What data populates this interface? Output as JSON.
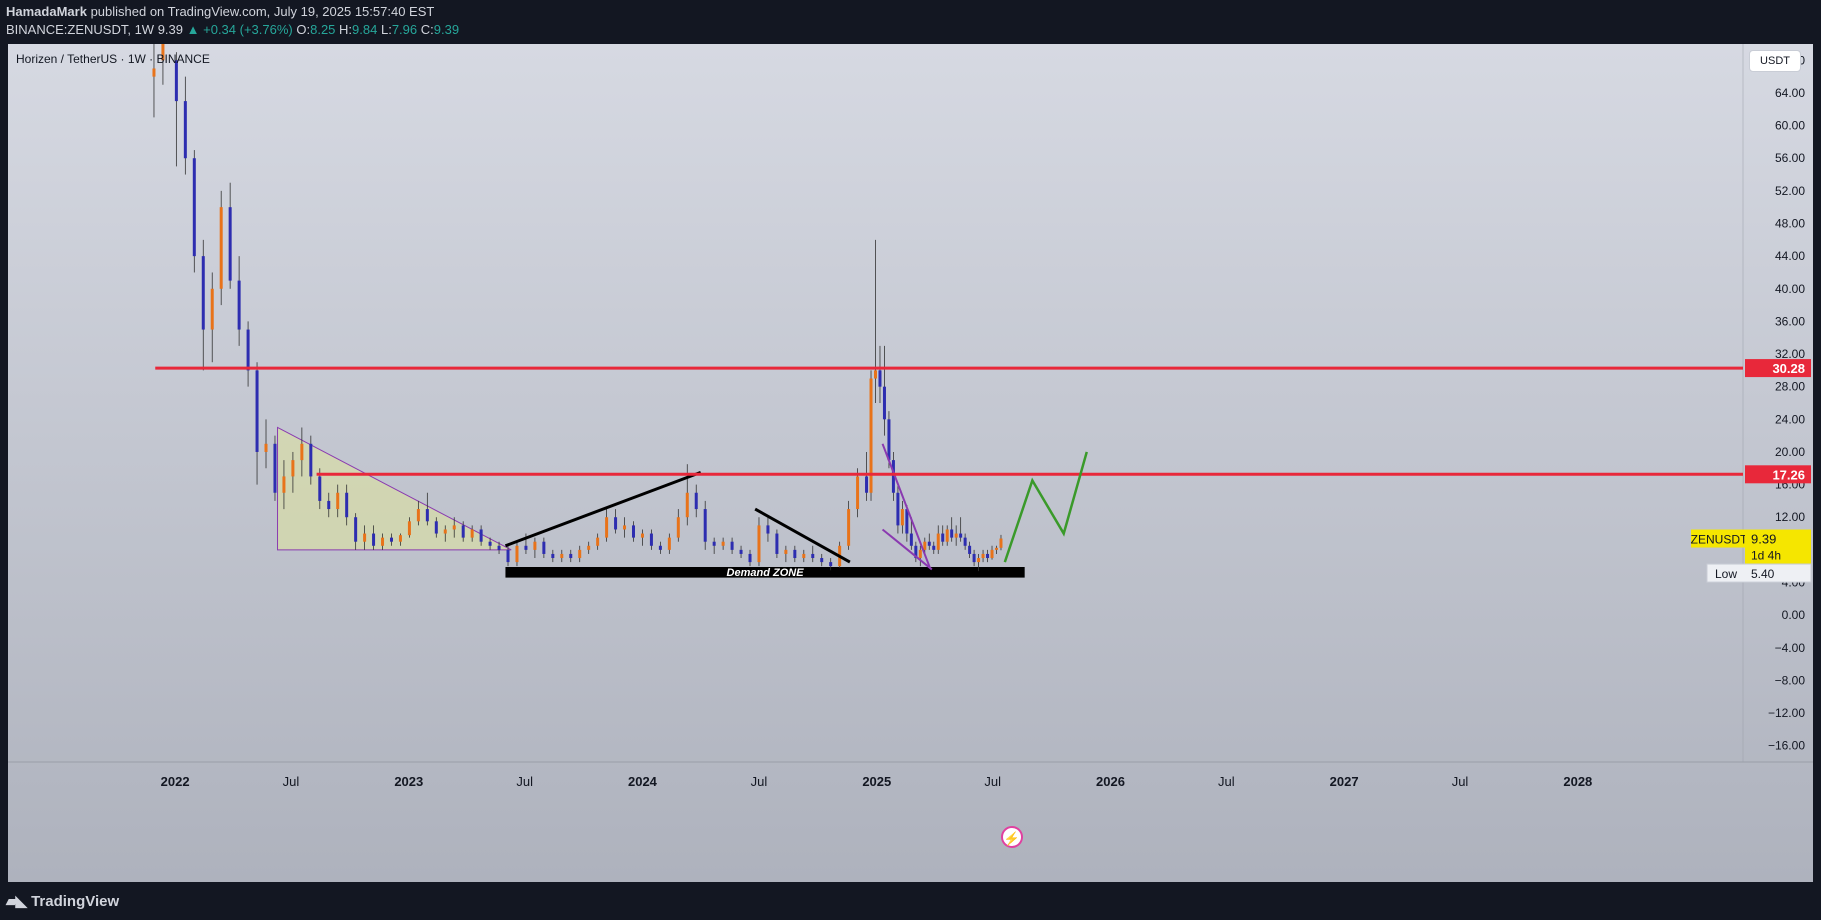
{
  "header": {
    "author": "HamadaMark",
    "published_text": "published on TradingView.com, July 19, 2025 15:57:40 EST",
    "symbol_full": "BINANCE:ZENUSDT, 1W",
    "last": "9.39",
    "change": "▲ +0.34 (+3.76%)",
    "o_label": "O:",
    "o_val": "8.25",
    "h_label": "H:",
    "h_val": "9.84",
    "l_label": "L:",
    "l_val": "7.96",
    "c_label": "C:",
    "c_val": "9.39"
  },
  "chart_title": "Horizen / TetherUS · 1W · BINANCE",
  "unit_button": "USDT",
  "footer": {
    "brand": "TradingView",
    "brand_icon": "tradingview-logo-icon"
  },
  "colors": {
    "bull": "#e8731a",
    "bear": "#2d2db0",
    "resistance": "#e8283a",
    "zen_label": "#f5e600",
    "projection": "#3a9a2a",
    "wedge": "#8a3ab0"
  },
  "chart_data": {
    "type": "candlestick",
    "title": "Horizen / TetherUS · 1W · BINANCE",
    "ylim": [
      -18,
      70
    ],
    "y_ticks": [
      "68.00",
      "64.00",
      "60.00",
      "56.00",
      "52.00",
      "48.00",
      "44.00",
      "40.00",
      "36.00",
      "32.00",
      "28.00",
      "24.00",
      "20.00",
      "16.00",
      "12.00",
      "8.00",
      "4.00",
      "0.00",
      "−4.00",
      "−8.00",
      "−12.00",
      "−16.00"
    ],
    "y_tick_values": [
      68,
      64,
      60,
      56,
      52,
      48,
      44,
      40,
      36,
      32,
      28,
      24,
      20,
      16,
      12,
      8,
      4,
      0,
      -4,
      -8,
      -12,
      -16
    ],
    "x_ticks": [
      "2022",
      "Jul",
      "2023",
      "Jul",
      "2024",
      "Jul",
      "2025",
      "Jul",
      "2026",
      "Jul",
      "2027",
      "Jul",
      "2028"
    ],
    "x_tick_dates": [
      "2022-01-01",
      "2022-07-01",
      "2023-01-01",
      "2023-07-01",
      "2024-01-01",
      "2024-07-01",
      "2025-01-01",
      "2025-07-01",
      "2026-01-01",
      "2026-07-01",
      "2027-01-01",
      "2027-07-01",
      "2028-01-01"
    ],
    "x_range": [
      "2021-04-15",
      "2028-09-15"
    ],
    "price_labels": [
      {
        "text": "30.28",
        "value": 30.28,
        "color": "#e8283a"
      },
      {
        "text": "17.26",
        "value": 17.26,
        "color": "#e8283a"
      }
    ],
    "symbol_label": {
      "name": "ZENUSDT",
      "price": "9.39",
      "countdown": "1d 4h",
      "value": 9.39
    },
    "low_label": {
      "name": "Low",
      "price": "5.40",
      "value": 5.4
    },
    "annotation": "Demand ZONE",
    "lines": [
      {
        "kind": "resistance",
        "from": "2021-12-01",
        "to": "2028-09-15",
        "value": 30.28
      },
      {
        "kind": "resistance",
        "from": "2022-08-10",
        "to": "2028-09-15",
        "value": 17.26
      }
    ],
    "candles": [
      {
        "d": "2021-11-29",
        "o": 66,
        "h": 70,
        "l": 61,
        "c": 67
      },
      {
        "d": "2021-12-13",
        "o": 68,
        "h": 71,
        "l": 65,
        "c": 70
      },
      {
        "d": "2022-01-03",
        "o": 68,
        "h": 69,
        "l": 55,
        "c": 63
      },
      {
        "d": "2022-01-17",
        "o": 63,
        "h": 66,
        "l": 54,
        "c": 56
      },
      {
        "d": "2022-01-31",
        "o": 56,
        "h": 57,
        "l": 42,
        "c": 44
      },
      {
        "d": "2022-02-14",
        "o": 44,
        "h": 46,
        "l": 30,
        "c": 35
      },
      {
        "d": "2022-02-28",
        "o": 35,
        "h": 42,
        "l": 31,
        "c": 40
      },
      {
        "d": "2022-03-14",
        "o": 40,
        "h": 52,
        "l": 38,
        "c": 50
      },
      {
        "d": "2022-03-28",
        "o": 50,
        "h": 53,
        "l": 40,
        "c": 41
      },
      {
        "d": "2022-04-11",
        "o": 41,
        "h": 44,
        "l": 33,
        "c": 35
      },
      {
        "d": "2022-04-25",
        "o": 35,
        "h": 36,
        "l": 28,
        "c": 30
      },
      {
        "d": "2022-05-09",
        "o": 30,
        "h": 31,
        "l": 16,
        "c": 20
      },
      {
        "d": "2022-05-23",
        "o": 20,
        "h": 24,
        "l": 18,
        "c": 21
      },
      {
        "d": "2022-06-06",
        "o": 21,
        "h": 22,
        "l": 14,
        "c": 15
      },
      {
        "d": "2022-06-20",
        "o": 15,
        "h": 19,
        "l": 13,
        "c": 17
      },
      {
        "d": "2022-07-04",
        "o": 17,
        "h": 20,
        "l": 15,
        "c": 19
      },
      {
        "d": "2022-07-18",
        "o": 19,
        "h": 23,
        "l": 17,
        "c": 21
      },
      {
        "d": "2022-08-01",
        "o": 21,
        "h": 22,
        "l": 16,
        "c": 17
      },
      {
        "d": "2022-08-15",
        "o": 17,
        "h": 18,
        "l": 13,
        "c": 14
      },
      {
        "d": "2022-08-29",
        "o": 14,
        "h": 15,
        "l": 12,
        "c": 13
      },
      {
        "d": "2022-09-12",
        "o": 13,
        "h": 16,
        "l": 12,
        "c": 15
      },
      {
        "d": "2022-09-26",
        "o": 15,
        "h": 16,
        "l": 11,
        "c": 12
      },
      {
        "d": "2022-10-10",
        "o": 12,
        "h": 12.5,
        "l": 8,
        "c": 9
      },
      {
        "d": "2022-10-24",
        "o": 9,
        "h": 11,
        "l": 8,
        "c": 10
      },
      {
        "d": "2022-11-07",
        "o": 10,
        "h": 11,
        "l": 8,
        "c": 8.5
      },
      {
        "d": "2022-11-21",
        "o": 8.5,
        "h": 10,
        "l": 8,
        "c": 9.5
      },
      {
        "d": "2022-12-05",
        "o": 9.5,
        "h": 10,
        "l": 8.5,
        "c": 9
      },
      {
        "d": "2022-12-19",
        "o": 9,
        "h": 10,
        "l": 8.5,
        "c": 9.8
      },
      {
        "d": "2023-01-02",
        "o": 9.8,
        "h": 12,
        "l": 9.5,
        "c": 11.5
      },
      {
        "d": "2023-01-16",
        "o": 11.5,
        "h": 14,
        "l": 11,
        "c": 13
      },
      {
        "d": "2023-01-30",
        "o": 13,
        "h": 15,
        "l": 11,
        "c": 11.5
      },
      {
        "d": "2023-02-13",
        "o": 11.5,
        "h": 12,
        "l": 9.5,
        "c": 10
      },
      {
        "d": "2023-02-27",
        "o": 10,
        "h": 11,
        "l": 9,
        "c": 10.5
      },
      {
        "d": "2023-03-13",
        "o": 10.5,
        "h": 12,
        "l": 9.5,
        "c": 11
      },
      {
        "d": "2023-03-27",
        "o": 11,
        "h": 11.5,
        "l": 9,
        "c": 9.5
      },
      {
        "d": "2023-04-10",
        "o": 9.5,
        "h": 11,
        "l": 9,
        "c": 10.5
      },
      {
        "d": "2023-04-24",
        "o": 10.5,
        "h": 11,
        "l": 8.5,
        "c": 9
      },
      {
        "d": "2023-05-08",
        "o": 9,
        "h": 9.5,
        "l": 8,
        "c": 8.5
      },
      {
        "d": "2023-05-22",
        "o": 8.5,
        "h": 9,
        "l": 7.5,
        "c": 8
      },
      {
        "d": "2023-06-05",
        "o": 8,
        "h": 8.5,
        "l": 6,
        "c": 6.5
      },
      {
        "d": "2023-06-19",
        "o": 6.5,
        "h": 9,
        "l": 6,
        "c": 8.5
      },
      {
        "d": "2023-07-03",
        "o": 8.5,
        "h": 10,
        "l": 7.5,
        "c": 8
      },
      {
        "d": "2023-07-17",
        "o": 8,
        "h": 9.5,
        "l": 7,
        "c": 9
      },
      {
        "d": "2023-07-31",
        "o": 9,
        "h": 9.5,
        "l": 7,
        "c": 7.5
      },
      {
        "d": "2023-08-14",
        "o": 7.5,
        "h": 8,
        "l": 6.5,
        "c": 7
      },
      {
        "d": "2023-08-28",
        "o": 7,
        "h": 8,
        "l": 6.5,
        "c": 7.5
      },
      {
        "d": "2023-09-11",
        "o": 7.5,
        "h": 8,
        "l": 6.5,
        "c": 7
      },
      {
        "d": "2023-09-25",
        "o": 7,
        "h": 8.5,
        "l": 6.5,
        "c": 8
      },
      {
        "d": "2023-10-09",
        "o": 8,
        "h": 9,
        "l": 7.5,
        "c": 8.5
      },
      {
        "d": "2023-10-23",
        "o": 8.5,
        "h": 10,
        "l": 8,
        "c": 9.5
      },
      {
        "d": "2023-11-06",
        "o": 9.5,
        "h": 13,
        "l": 9,
        "c": 12
      },
      {
        "d": "2023-11-20",
        "o": 12,
        "h": 13,
        "l": 10,
        "c": 10.5
      },
      {
        "d": "2023-12-04",
        "o": 10.5,
        "h": 12,
        "l": 9.5,
        "c": 11
      },
      {
        "d": "2023-12-18",
        "o": 11,
        "h": 11.5,
        "l": 9,
        "c": 9.5
      },
      {
        "d": "2024-01-01",
        "o": 9.5,
        "h": 10.5,
        "l": 8.5,
        "c": 10
      },
      {
        "d": "2024-01-15",
        "o": 10,
        "h": 10.5,
        "l": 8,
        "c": 8.5
      },
      {
        "d": "2024-01-29",
        "o": 8.5,
        "h": 9,
        "l": 7.5,
        "c": 8
      },
      {
        "d": "2024-02-12",
        "o": 8,
        "h": 10,
        "l": 7.5,
        "c": 9.5
      },
      {
        "d": "2024-02-26",
        "o": 9.5,
        "h": 13,
        "l": 9,
        "c": 12
      },
      {
        "d": "2024-03-11",
        "o": 12,
        "h": 18.5,
        "l": 11,
        "c": 15
      },
      {
        "d": "2024-03-25",
        "o": 15,
        "h": 16,
        "l": 12,
        "c": 13
      },
      {
        "d": "2024-04-08",
        "o": 13,
        "h": 14,
        "l": 8,
        "c": 9
      },
      {
        "d": "2024-04-22",
        "o": 9,
        "h": 9.5,
        "l": 7.5,
        "c": 8.5
      },
      {
        "d": "2024-05-06",
        "o": 8.5,
        "h": 9.5,
        "l": 8,
        "c": 9
      },
      {
        "d": "2024-05-20",
        "o": 9,
        "h": 9.5,
        "l": 7.5,
        "c": 8
      },
      {
        "d": "2024-06-03",
        "o": 8,
        "h": 8.5,
        "l": 7,
        "c": 7.5
      },
      {
        "d": "2024-06-17",
        "o": 7.5,
        "h": 8,
        "l": 6,
        "c": 6.5
      },
      {
        "d": "2024-07-01",
        "o": 6.5,
        "h": 12,
        "l": 6,
        "c": 11
      },
      {
        "d": "2024-07-15",
        "o": 11,
        "h": 12,
        "l": 9,
        "c": 10
      },
      {
        "d": "2024-07-29",
        "o": 10,
        "h": 10.5,
        "l": 7,
        "c": 7.5
      },
      {
        "d": "2024-08-12",
        "o": 7.5,
        "h": 8.5,
        "l": 6.5,
        "c": 8
      },
      {
        "d": "2024-08-26",
        "o": 8,
        "h": 8.5,
        "l": 6.5,
        "c": 7
      },
      {
        "d": "2024-09-09",
        "o": 7,
        "h": 8,
        "l": 6.5,
        "c": 7.5
      },
      {
        "d": "2024-09-23",
        "o": 7.5,
        "h": 8.5,
        "l": 6.5,
        "c": 7
      },
      {
        "d": "2024-10-07",
        "o": 7,
        "h": 7.5,
        "l": 6,
        "c": 6.5
      },
      {
        "d": "2024-10-21",
        "o": 6.5,
        "h": 7,
        "l": 5.5,
        "c": 6
      },
      {
        "d": "2024-11-04",
        "o": 6,
        "h": 9,
        "l": 5.8,
        "c": 8.5
      },
      {
        "d": "2024-11-18",
        "o": 8.5,
        "h": 14,
        "l": 8,
        "c": 13
      },
      {
        "d": "2024-12-02",
        "o": 13,
        "h": 18,
        "l": 12,
        "c": 17
      },
      {
        "d": "2024-12-16",
        "o": 17,
        "h": 20,
        "l": 14,
        "c": 15
      },
      {
        "d": "2024-12-23",
        "o": 15,
        "h": 30,
        "l": 14,
        "c": 29
      },
      {
        "d": "2024-12-30",
        "o": 29,
        "h": 46,
        "l": 26,
        "c": 30
      },
      {
        "d": "2025-01-06",
        "o": 30,
        "h": 33,
        "l": 26,
        "c": 28
      },
      {
        "d": "2025-01-13",
        "o": 28,
        "h": 33,
        "l": 22,
        "c": 24
      },
      {
        "d": "2025-01-20",
        "o": 24,
        "h": 25,
        "l": 18,
        "c": 19
      },
      {
        "d": "2025-01-27",
        "o": 19,
        "h": 20,
        "l": 14,
        "c": 15
      },
      {
        "d": "2025-02-03",
        "o": 15,
        "h": 16,
        "l": 10,
        "c": 11
      },
      {
        "d": "2025-02-10",
        "o": 11,
        "h": 14,
        "l": 10,
        "c": 13
      },
      {
        "d": "2025-02-17",
        "o": 13,
        "h": 13.5,
        "l": 9,
        "c": 10
      },
      {
        "d": "2025-02-24",
        "o": 10,
        "h": 12,
        "l": 8,
        "c": 8.5
      },
      {
        "d": "2025-03-03",
        "o": 8.5,
        "h": 9,
        "l": 6.5,
        "c": 7
      },
      {
        "d": "2025-03-10",
        "o": 7,
        "h": 8.5,
        "l": 6,
        "c": 8
      },
      {
        "d": "2025-03-17",
        "o": 8,
        "h": 9.5,
        "l": 7.5,
        "c": 9
      },
      {
        "d": "2025-03-24",
        "o": 9,
        "h": 10,
        "l": 8,
        "c": 8.5
      },
      {
        "d": "2025-03-31",
        "o": 8.5,
        "h": 9,
        "l": 7.5,
        "c": 8
      },
      {
        "d": "2025-04-07",
        "o": 8,
        "h": 11,
        "l": 7.5,
        "c": 10
      },
      {
        "d": "2025-04-14",
        "o": 10,
        "h": 11,
        "l": 8.5,
        "c": 9
      },
      {
        "d": "2025-04-21",
        "o": 9,
        "h": 11,
        "l": 8.5,
        "c": 10.5
      },
      {
        "d": "2025-04-28",
        "o": 10.5,
        "h": 12,
        "l": 9,
        "c": 9.5
      },
      {
        "d": "2025-05-05",
        "o": 9.5,
        "h": 11,
        "l": 8.5,
        "c": 10
      },
      {
        "d": "2025-05-12",
        "o": 10,
        "h": 12,
        "l": 9,
        "c": 9.5
      },
      {
        "d": "2025-05-19",
        "o": 9.5,
        "h": 10,
        "l": 8,
        "c": 8.5
      },
      {
        "d": "2025-05-26",
        "o": 8.5,
        "h": 9,
        "l": 7,
        "c": 7.5
      },
      {
        "d": "2025-06-02",
        "o": 7.5,
        "h": 8,
        "l": 6,
        "c": 6.5
      },
      {
        "d": "2025-06-09",
        "o": 6.5,
        "h": 7.5,
        "l": 5.4,
        "c": 7
      },
      {
        "d": "2025-06-16",
        "o": 7,
        "h": 8,
        "l": 6.5,
        "c": 7.5
      },
      {
        "d": "2025-06-23",
        "o": 7.5,
        "h": 8,
        "l": 6.5,
        "c": 7
      },
      {
        "d": "2025-06-30",
        "o": 7,
        "h": 8.5,
        "l": 6.8,
        "c": 8
      },
      {
        "d": "2025-07-07",
        "o": 8,
        "h": 8.5,
        "l": 7.5,
        "c": 8.25
      },
      {
        "d": "2025-07-14",
        "o": 8.25,
        "h": 9.84,
        "l": 7.96,
        "c": 9.39
      }
    ]
  }
}
